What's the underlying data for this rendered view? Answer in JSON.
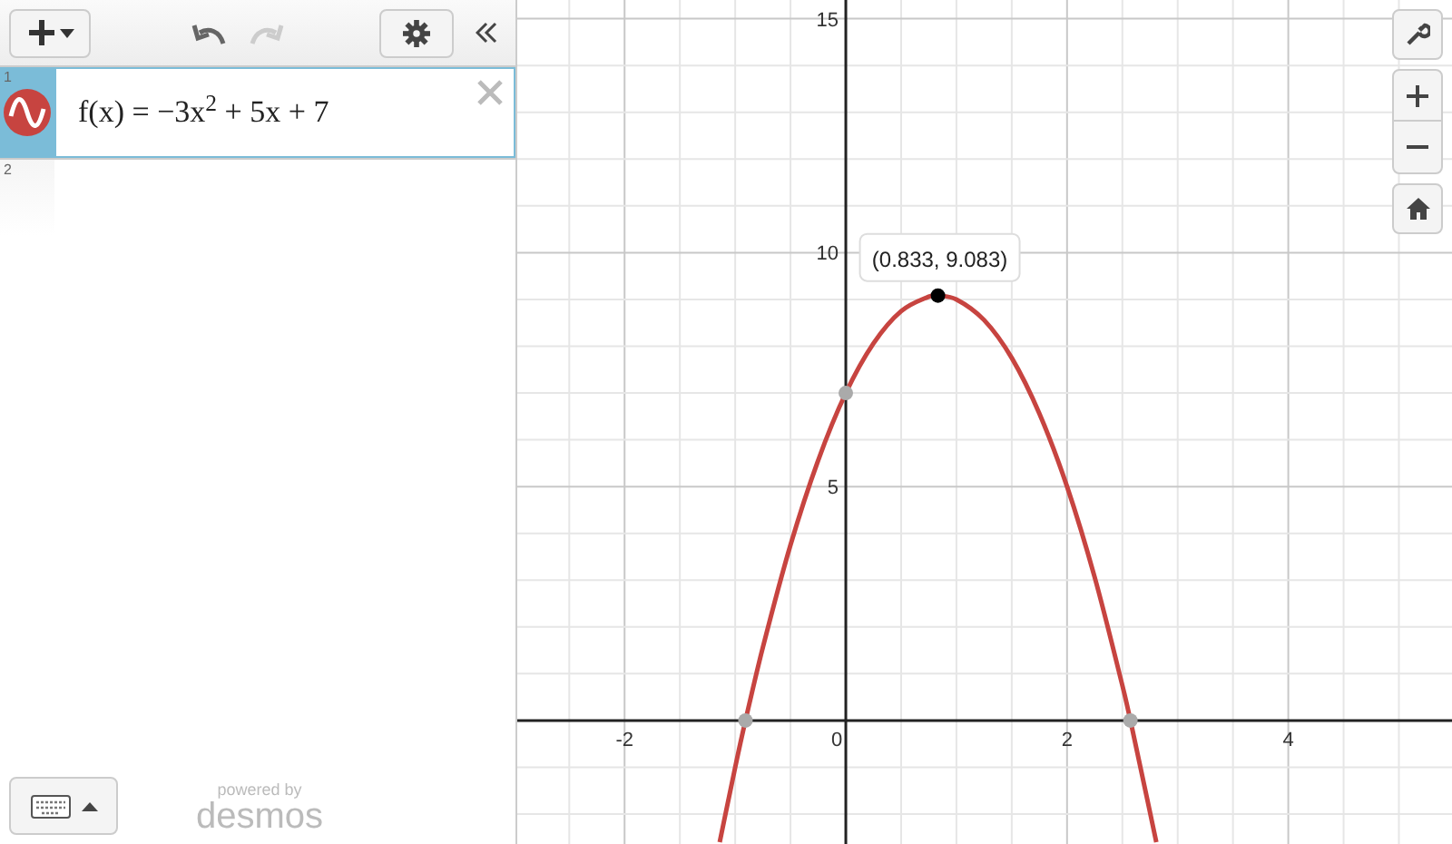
{
  "toolbar": {
    "undo_enabled": true,
    "redo_enabled": false
  },
  "expressions": [
    {
      "number": "1",
      "latex": "f(x) = −3x$^{2}$ + 5x + 7",
      "selected": true,
      "color": "#c74440"
    },
    {
      "number": "2",
      "selected": false
    }
  ],
  "branding": {
    "line_1": "powered by",
    "line_2": "desmos"
  },
  "graph": {
    "chart_data": {
      "type": "line",
      "grid": true,
      "xlim": [
        -2.97,
        5.48
      ],
      "ylim": [
        -2.64,
        15.4
      ],
      "xticks": [
        -2,
        0,
        2,
        4
      ],
      "yticks": [
        5,
        10,
        15
      ],
      "x": [
        -1.14,
        -1,
        -0.907,
        -0.75,
        -0.5,
        -0.25,
        0,
        0.25,
        0.5,
        0.75,
        0.833,
        1,
        1.25,
        1.5,
        1.75,
        2,
        2.25,
        2.5,
        2.573,
        2.807
      ],
      "series": [
        {
          "color": "#c74440",
          "values": [
            -2.6,
            -1,
            0,
            1.56,
            3.75,
            5.56,
            7,
            8.06,
            8.75,
            9.06,
            9.08,
            9,
            8.56,
            7.75,
            6.56,
            5,
            3.06,
            0.75,
            0,
            -2.6
          ]
        },
        {
          "color": "#000000",
          "marker": true,
          "values": [
            null,
            null,
            null,
            null,
            null,
            null,
            null,
            null,
            null,
            null,
            9.083,
            null,
            null,
            null,
            null,
            null,
            null,
            null,
            null,
            null
          ]
        }
      ],
      "annotations": [
        {
          "x": 0.833,
          "y": 9.083,
          "text": "(0.833, 9.083)"
        }
      ]
    }
  }
}
